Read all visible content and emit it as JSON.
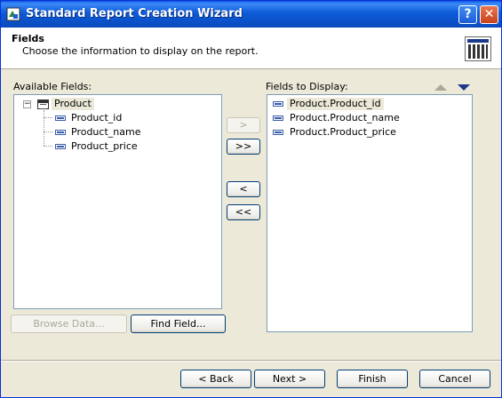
{
  "window": {
    "title": "Standard Report Creation Wizard",
    "help_label": "?",
    "close_label": "✕"
  },
  "header": {
    "title": "Fields",
    "subtitle": "Choose the information to display on the report."
  },
  "available": {
    "label": "Available Fields:",
    "table": "Product",
    "fields": [
      "Product_id",
      "Product_name",
      "Product_price"
    ]
  },
  "display": {
    "label": "Fields to Display:",
    "fields": [
      "Product.Product_id",
      "Product.Product_name",
      "Product.Product_price"
    ]
  },
  "transfer": {
    "add": ">",
    "add_all": ">>",
    "remove": "<",
    "remove_all": "<<"
  },
  "actions": {
    "browse": "Browse Data...",
    "find": "Find Field..."
  },
  "footer": {
    "back": "< Back",
    "next": "Next >",
    "finish": "Finish",
    "cancel": "Cancel"
  }
}
